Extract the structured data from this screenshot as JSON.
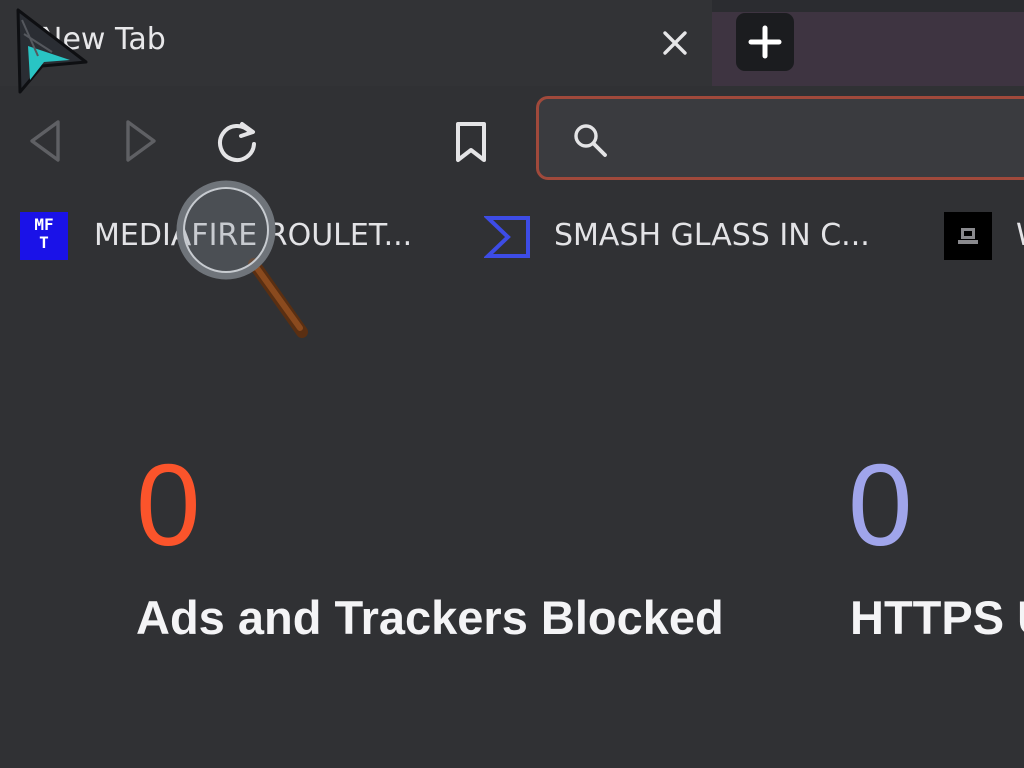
{
  "tab": {
    "title": "New Tab",
    "close_icon": "close-icon",
    "new_tab_icon": "plus-icon"
  },
  "toolbar": {
    "back_icon": "back-arrow-icon",
    "forward_icon": "forward-arrow-icon",
    "reload_icon": "reload-icon",
    "bookmark_icon": "bookmark-icon",
    "search_icon": "search-icon",
    "address_value": ""
  },
  "bookmarks": [
    {
      "favicon_text_line1": "MF",
      "favicon_text_line2": "T",
      "label": "MEDIAFIRE ROULET..."
    },
    {
      "favicon": "sigma-flag-icon",
      "label": "SMASH GLASS IN C..."
    },
    {
      "favicon": "laptop-icon",
      "label": "W"
    }
  ],
  "stats": {
    "ads_count": "0",
    "ads_label": "Ads and Trackers Blocked",
    "https_count": "0",
    "https_label": "HTTPS Upgrades"
  },
  "colors": {
    "background": "#303134",
    "omnibox_border": "#a0493b",
    "ads_count": "#fb542b",
    "https_count": "#a0a5eb",
    "bookmark_mf_bg": "#1a12e8"
  },
  "overlays": {
    "cursor_icon": "arrow-cursor-icon",
    "magnifier_icon": "magnifier-cursor-icon"
  }
}
